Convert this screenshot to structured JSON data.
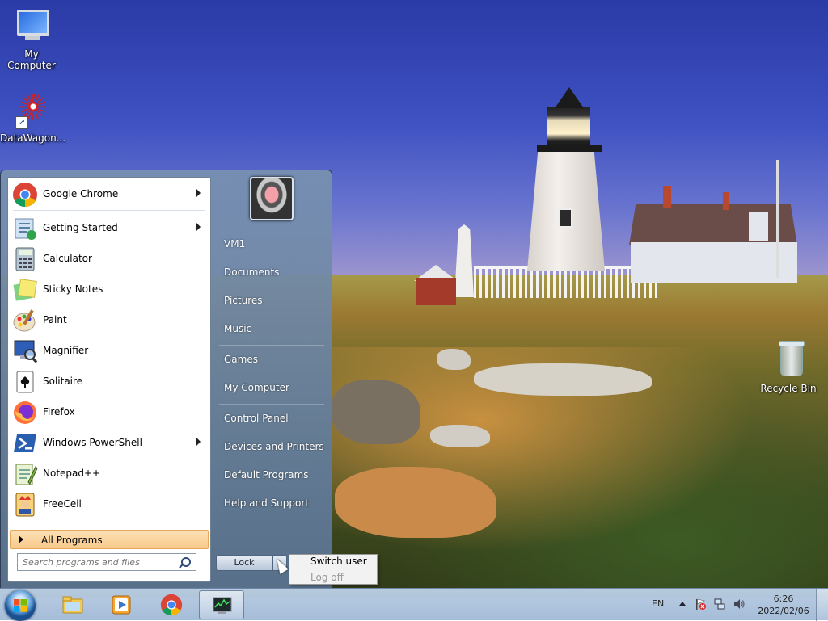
{
  "desktop": {
    "icons": [
      {
        "label": "My Computer"
      },
      {
        "label": "DataWagon..."
      },
      {
        "label": "Recycle Bin"
      }
    ]
  },
  "start_menu": {
    "programs": [
      {
        "label": "Google Chrome",
        "icon": "chrome-icon",
        "has_submenu": true
      },
      {
        "label": "Getting Started",
        "icon": "getting-started-icon",
        "has_submenu": true
      },
      {
        "label": "Calculator",
        "icon": "calculator-icon",
        "has_submenu": false
      },
      {
        "label": "Sticky Notes",
        "icon": "sticky-notes-icon",
        "has_submenu": false
      },
      {
        "label": "Paint",
        "icon": "paint-icon",
        "has_submenu": false
      },
      {
        "label": "Magnifier",
        "icon": "magnifier-icon",
        "has_submenu": false
      },
      {
        "label": "Solitaire",
        "icon": "solitaire-icon",
        "has_submenu": false
      },
      {
        "label": "Firefox",
        "icon": "firefox-icon",
        "has_submenu": false
      },
      {
        "label": "Windows PowerShell",
        "icon": "powershell-icon",
        "has_submenu": true
      },
      {
        "label": "Notepad++",
        "icon": "notepadpp-icon",
        "has_submenu": false
      },
      {
        "label": "FreeCell",
        "icon": "freecell-icon",
        "has_submenu": false
      }
    ],
    "all_programs": "All Programs",
    "search_placeholder": "Search programs and files",
    "right_links": {
      "user": "VM1",
      "documents": "Documents",
      "pictures": "Pictures",
      "music": "Music",
      "games": "Games",
      "computer": "My Computer",
      "control_panel": "Control Panel",
      "devices": "Devices and Printers",
      "default_programs": "Default Programs",
      "help": "Help and Support"
    },
    "lock_label": "Lock",
    "power_menu": {
      "switch_user": "Switch user",
      "log_off": "Log off"
    }
  },
  "taskbar": {
    "pinned": [
      {
        "name": "explorer-icon"
      },
      {
        "name": "media-player-icon"
      },
      {
        "name": "chrome-icon"
      },
      {
        "name": "task-manager-icon",
        "active": true
      }
    ],
    "language": "EN",
    "clock": {
      "time": "6:26",
      "date": "2022/02/06"
    }
  },
  "colors": {
    "menu_highlight": "#f7c98a",
    "taskbar": "#b4c8e0"
  }
}
